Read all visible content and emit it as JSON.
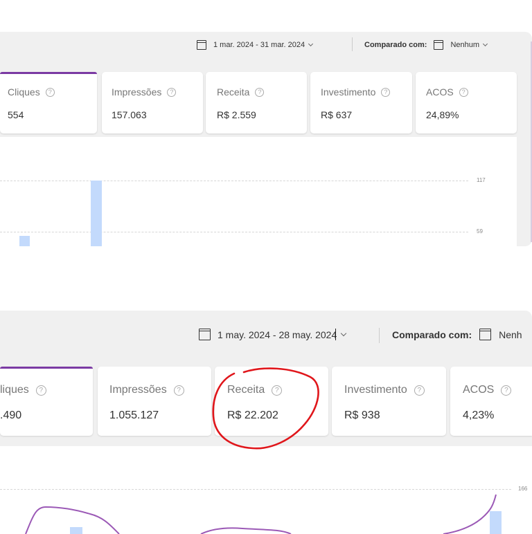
{
  "top": {
    "date_range": "1 mar. 2024 - 31 mar. 2024",
    "compare_label": "Comparado com:",
    "compare_value": "Nenhum",
    "cards": [
      {
        "label": "Cliques",
        "value": "554"
      },
      {
        "label": "Impressões",
        "value": "157.063"
      },
      {
        "label": "Receita",
        "value": "R$ 2.559"
      },
      {
        "label": "Investimento",
        "value": "R$ 637"
      },
      {
        "label": "ACOS",
        "value": "24,89%"
      }
    ],
    "chart": {
      "ticks": [
        "117",
        "59"
      ],
      "bars": [
        10,
        117
      ]
    }
  },
  "bottom": {
    "date_range": "1 may. 2024 - 28 may. 2024",
    "compare_label": "Comparado com:",
    "compare_value": "Nenh",
    "cards": [
      {
        "label": "liques",
        "value": ".490"
      },
      {
        "label": "Impressões",
        "value": "1.055.127"
      },
      {
        "label": "Receita",
        "value": "R$ 22.202"
      },
      {
        "label": "Investimento",
        "value": "R$ 938"
      },
      {
        "label": "ACOS",
        "value": "4,23%"
      }
    ],
    "chart": {
      "ticks": [
        "166"
      ]
    }
  },
  "help_glyph": "?",
  "icons": [
    "calendar-icon",
    "chevron-down-icon",
    "help-icon"
  ],
  "colors": {
    "accent": "#7b3aa3",
    "bar": "#c3dafc",
    "line": "#9b59b6",
    "highlight": "#e0161b"
  }
}
